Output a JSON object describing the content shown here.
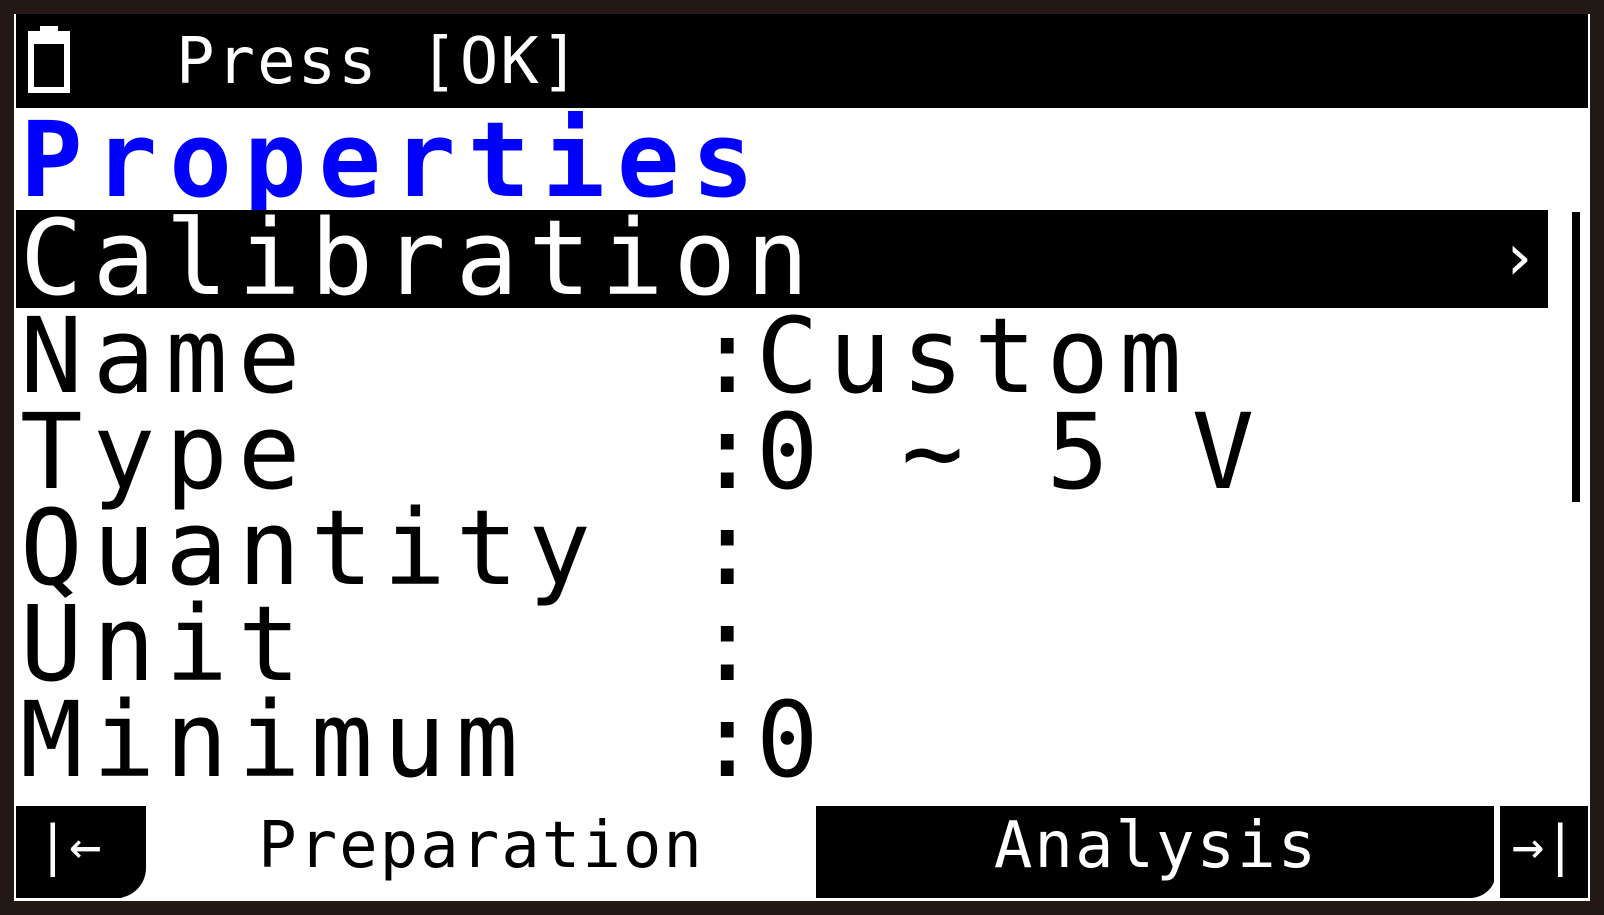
{
  "status_bar": {
    "battery_icon": "battery-icon",
    "prompt": "Press [OK]"
  },
  "title": "Properties",
  "list": [
    {
      "label": "Calibration",
      "value": "",
      "selected": true,
      "chevron": "›"
    },
    {
      "label": "Name",
      "separator": ":",
      "value": "Custom"
    },
    {
      "label": "Type",
      "separator": ":",
      "value": "0 ~ 5 V"
    },
    {
      "label": "Quantity",
      "separator": ":",
      "value": ""
    },
    {
      "label": "Unit",
      "separator": ":",
      "value": ""
    },
    {
      "label": "Minimum",
      "separator": ":",
      "value": "0"
    }
  ],
  "tabs": {
    "prev_glyph": "|←",
    "left": "Preparation",
    "right": "Analysis",
    "next_glyph": "→|"
  },
  "colors": {
    "title": "#0000ff",
    "frame": "#231815"
  }
}
